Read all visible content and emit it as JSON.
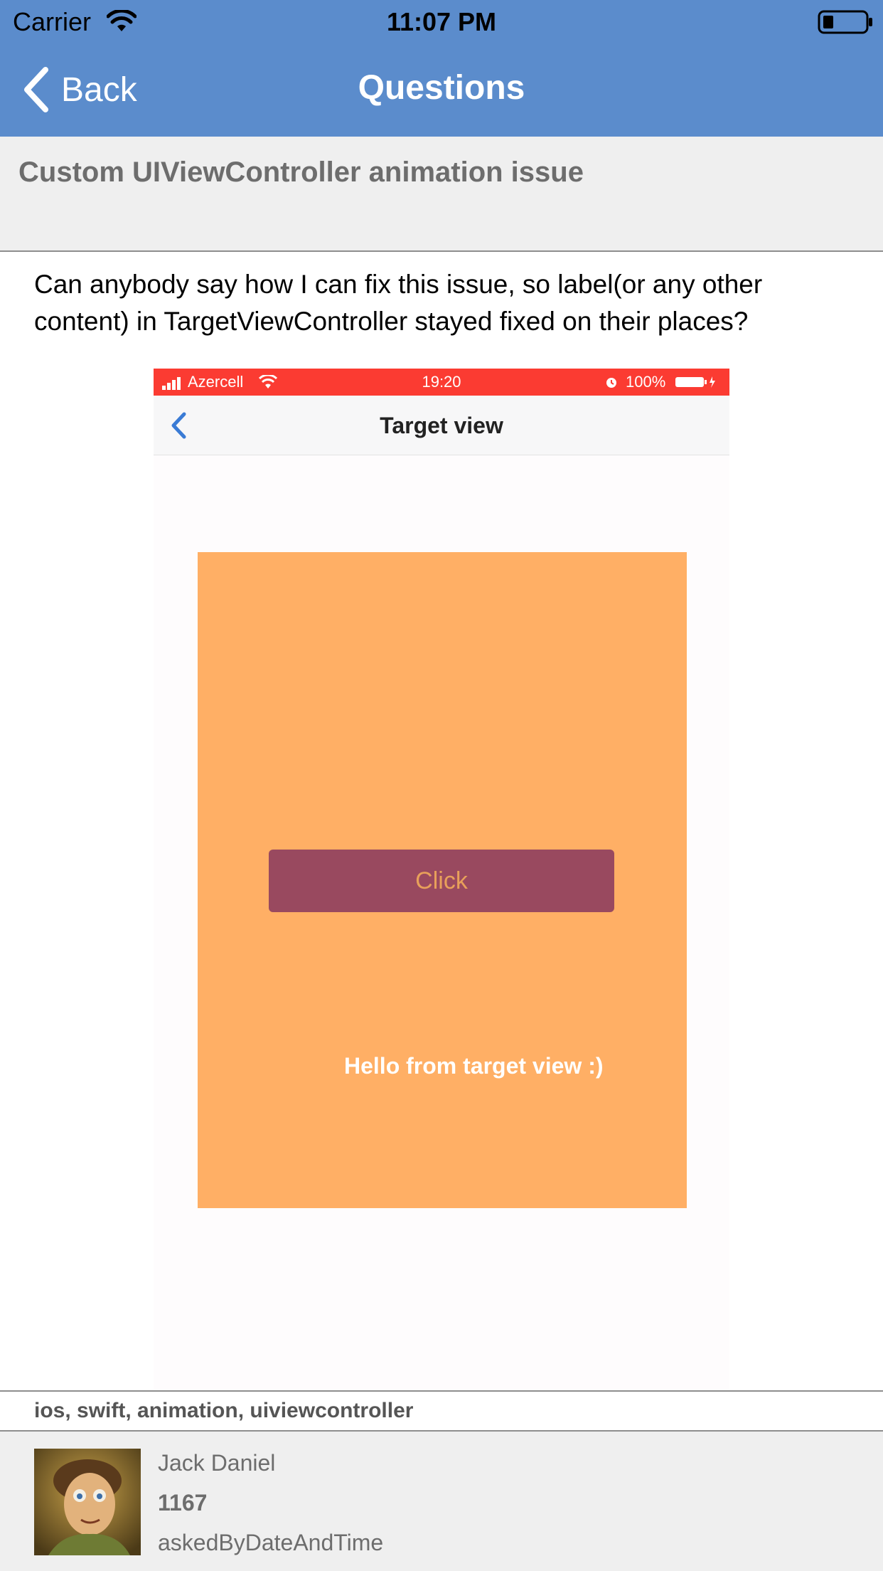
{
  "status_bar": {
    "carrier": "Carrier",
    "time": "11:07 PM"
  },
  "nav": {
    "back_label": "Back",
    "title": "Questions"
  },
  "question": {
    "title": "Custom UIViewController animation issue",
    "body": "Can anybody say how I can fix this issue, so label(or any other content) in TargetViewController stayed fixed on their places?",
    "tags": "ios, swift, animation, uiviewcontroller"
  },
  "embedded_image": {
    "status_carrier": "Azercell",
    "status_time": "19:20",
    "status_battery": "100%",
    "nav_title": "Target view",
    "button_label": "Click",
    "label_text": "Hello from target view :)",
    "colors": {
      "status_bar": "#fb3b32",
      "panel": "#ffaf65",
      "button": "#99495f"
    }
  },
  "author": {
    "name": "Jack Daniel",
    "reputation": "1167",
    "asked": "askedByDateAndTime"
  },
  "colors": {
    "nav_bar": "#5b8ccc",
    "title_band": "#efefef"
  }
}
